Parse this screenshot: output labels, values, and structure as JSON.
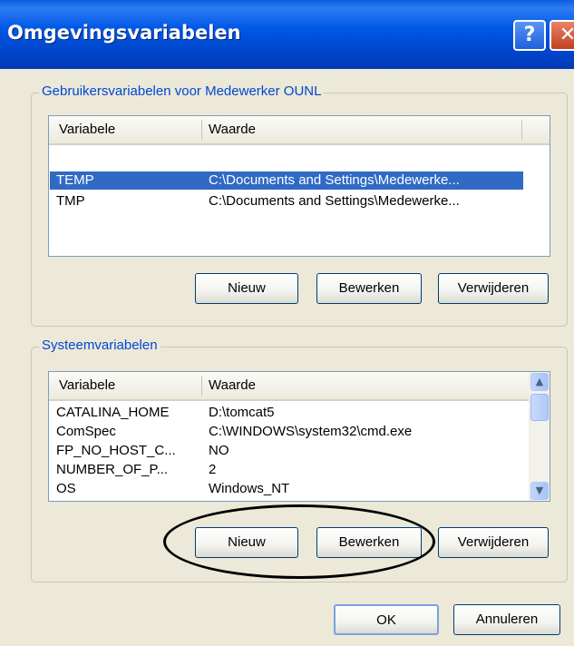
{
  "window": {
    "title": "Omgevingsvariabelen"
  },
  "titlebar": {
    "help": "?",
    "close": "✕"
  },
  "user_group": {
    "legend": "Gebruikersvariabelen voor Medewerker OUNL",
    "columns": [
      "Variabele",
      "Waarde"
    ],
    "rows": [
      {
        "name": "TEMP",
        "value": "C:\\Documents and Settings\\Medewerke...",
        "selected": true
      },
      {
        "name": "TMP",
        "value": "C:\\Documents and Settings\\Medewerke...",
        "selected": false
      }
    ],
    "buttons": {
      "new": "Nieuw",
      "edit": "Bewerken",
      "delete": "Verwijderen"
    }
  },
  "system_group": {
    "legend": "Systeemvariabelen",
    "columns": [
      "Variabele",
      "Waarde"
    ],
    "rows": [
      {
        "name": "CATALINA_HOME",
        "value": "D:\\tomcat5"
      },
      {
        "name": "ComSpec",
        "value": "C:\\WINDOWS\\system32\\cmd.exe"
      },
      {
        "name": "FP_NO_HOST_C...",
        "value": "NO"
      },
      {
        "name": "NUMBER_OF_P...",
        "value": "2"
      },
      {
        "name": "OS",
        "value": "Windows_NT"
      }
    ],
    "buttons": {
      "new": "Nieuw",
      "edit": "Bewerken",
      "delete": "Verwijderen"
    }
  },
  "footer": {
    "ok": "OK",
    "cancel": "Annuleren"
  }
}
